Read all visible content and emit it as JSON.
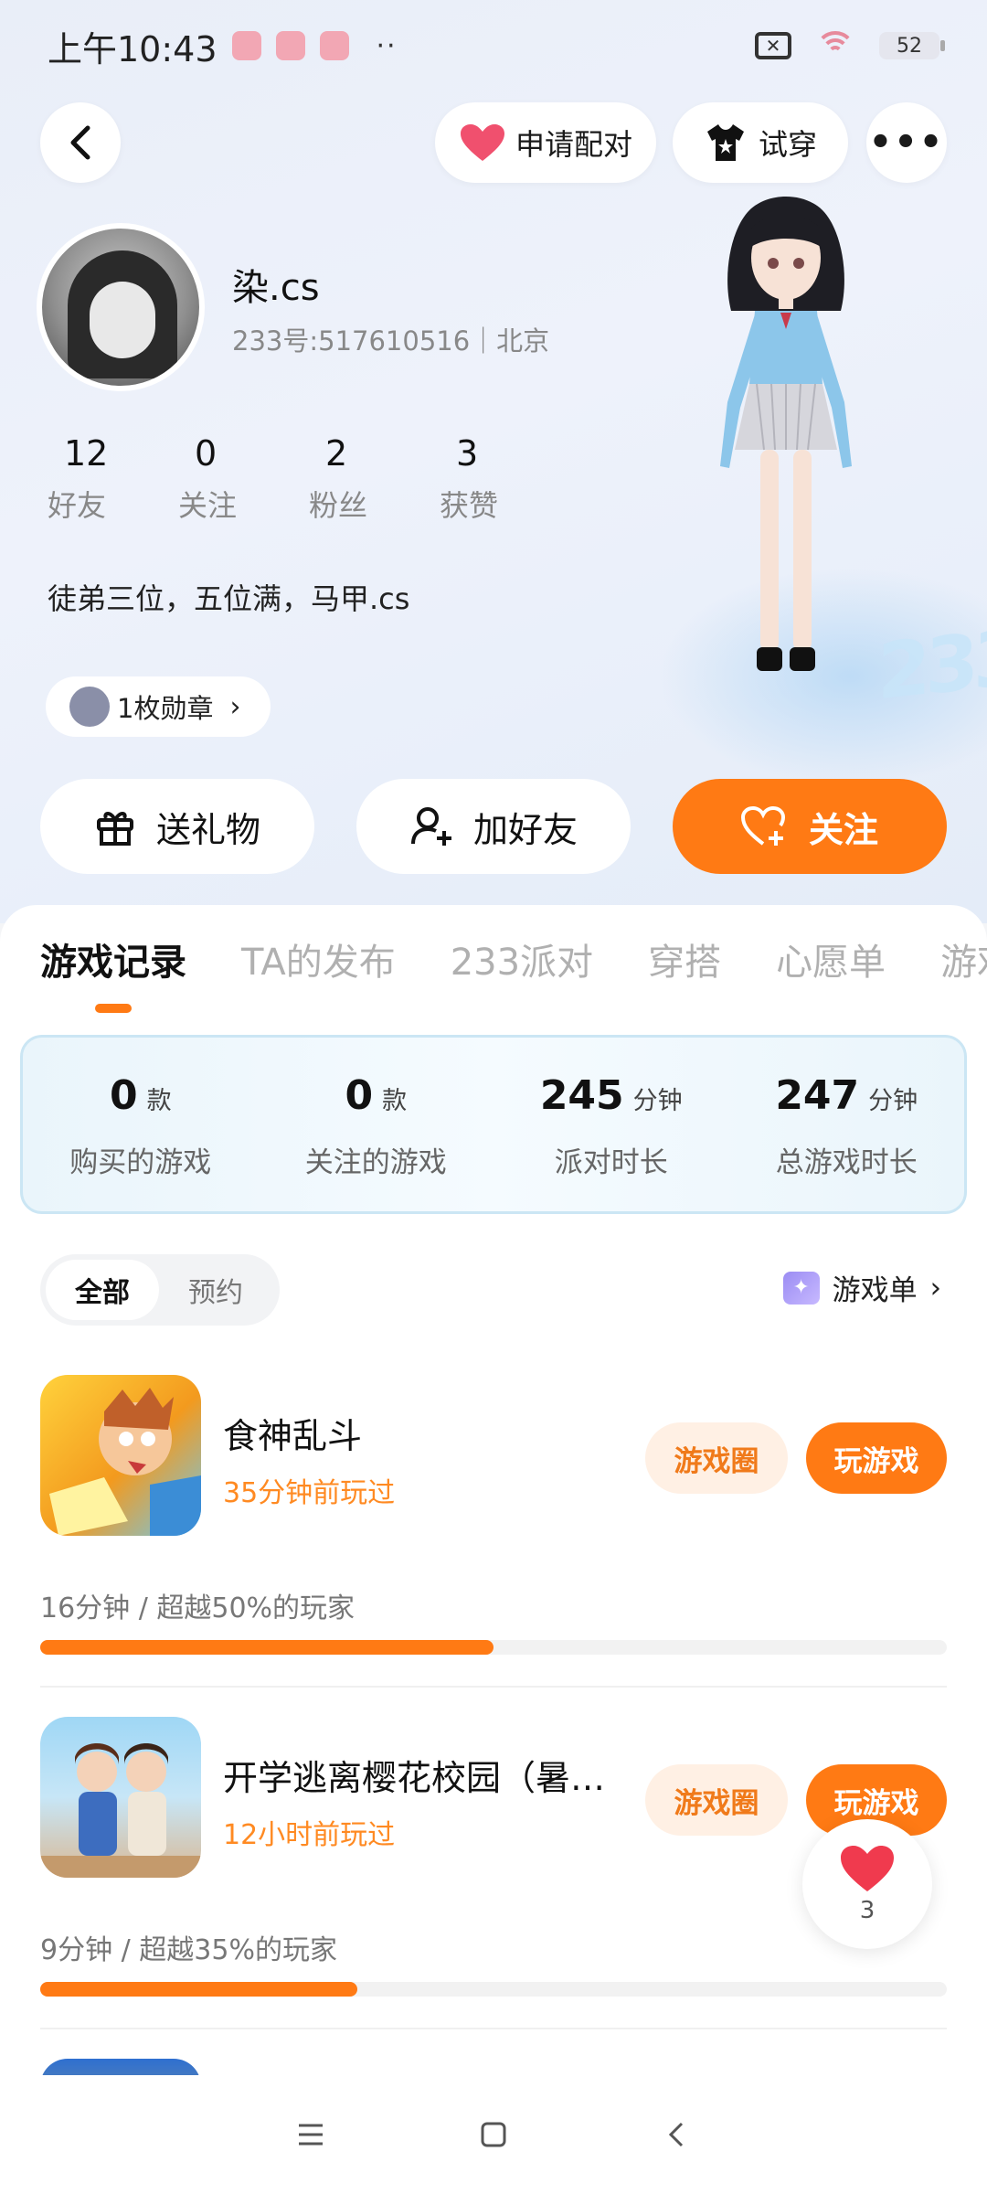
{
  "status": {
    "time": "上午10:43",
    "battery": "52"
  },
  "topnav": {
    "pair_label": "申请配对",
    "try_label": "试穿"
  },
  "profile": {
    "name": "染.cs",
    "id_line": "233号:517610516｜北京",
    "stats": [
      {
        "value": "12",
        "label": "好友"
      },
      {
        "value": "0",
        "label": "关注"
      },
      {
        "value": "2",
        "label": "粉丝"
      },
      {
        "value": "3",
        "label": "获赞"
      }
    ],
    "bio": "徒弟三位，五位满，马甲.cs",
    "medal": "1枚勋章"
  },
  "actions": {
    "gift": "送礼物",
    "add_friend": "加好友",
    "follow": "关注"
  },
  "tabs": [
    "游戏记录",
    "TA的发布",
    "233派对",
    "穿搭",
    "心愿单",
    "游戏"
  ],
  "summary": [
    {
      "value": "0",
      "unit": "款",
      "label": "购买的游戏"
    },
    {
      "value": "0",
      "unit": "款",
      "label": "关注的游戏"
    },
    {
      "value": "245",
      "unit": "分钟",
      "label": "派对时长"
    },
    {
      "value": "247",
      "unit": "分钟",
      "label": "总游戏时长"
    }
  ],
  "filter": {
    "all": "全部",
    "reserve": "预约",
    "gamelist": "游戏单"
  },
  "games": [
    {
      "name": "食神乱斗",
      "played": "35分钟前玩过",
      "circle": "游戏圈",
      "play": "玩游戏",
      "stat": "16分钟 / 超越50%的玩家",
      "progress": 0.5
    },
    {
      "name": "开学逃离樱花校园（暑假版）",
      "played": "12小时前玩过",
      "circle": "游戏圈",
      "play": "玩游戏",
      "stat": "9分钟 / 超越35%的玩家",
      "progress": 0.35
    }
  ],
  "like_count": "3",
  "colors": {
    "accent": "#ff7a14",
    "accent_soft": "#fff0e4",
    "played": "#ff8a22"
  }
}
